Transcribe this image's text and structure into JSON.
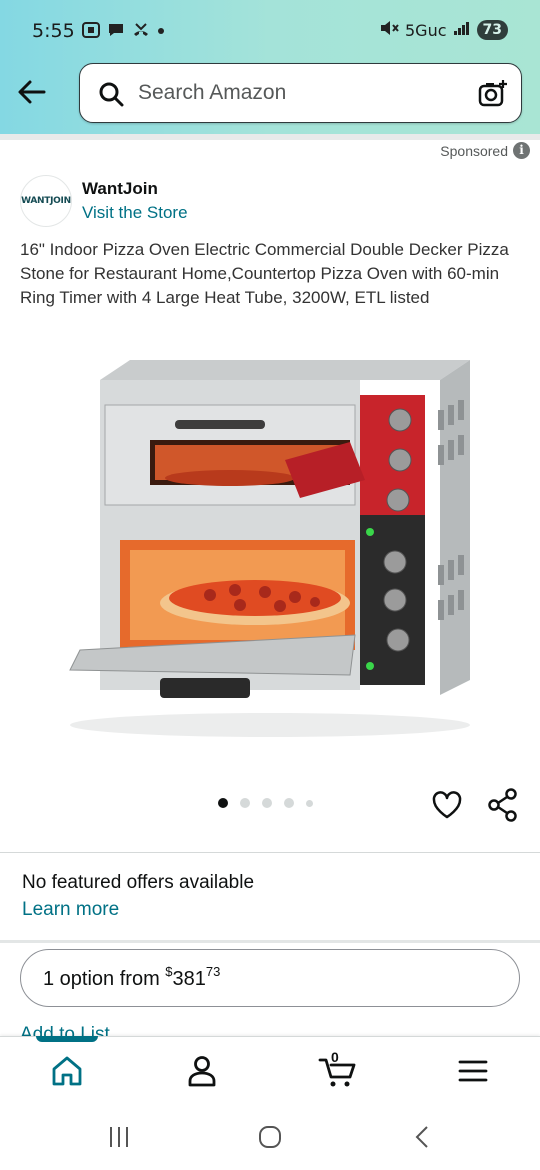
{
  "status_bar": {
    "time": "5:55",
    "network": "5Guc",
    "battery": "73"
  },
  "search": {
    "placeholder": "Search Amazon"
  },
  "ad": {
    "sponsored_label": "Sponsored",
    "brand_logo_text": "WANTJOIN",
    "brand_name": "WantJoin",
    "visit_store": "Visit the Store",
    "title": "16\" Indoor Pizza Oven Electric Commercial Double Decker Pizza Stone for Restaurant Home,Countertop Pizza Oven with 60-min Ring Timer with 4 Large Heat Tube, 3200W, ETL listed"
  },
  "carousel": {
    "dot_count": 5,
    "active_index": 0
  },
  "offers": {
    "no_offers_text": "No featured offers available",
    "learn_more": "Learn more"
  },
  "option": {
    "prefix": "1 option from ",
    "currency": "$",
    "whole": "381",
    "fraction": "73"
  },
  "add_to_list": "Add to List",
  "bottom_nav": {
    "cart_count": "0",
    "active": "home"
  },
  "colors": {
    "accent_link": "#007185",
    "header_gradient_start": "#84d8e3",
    "header_gradient_end": "#a9e5d4"
  }
}
